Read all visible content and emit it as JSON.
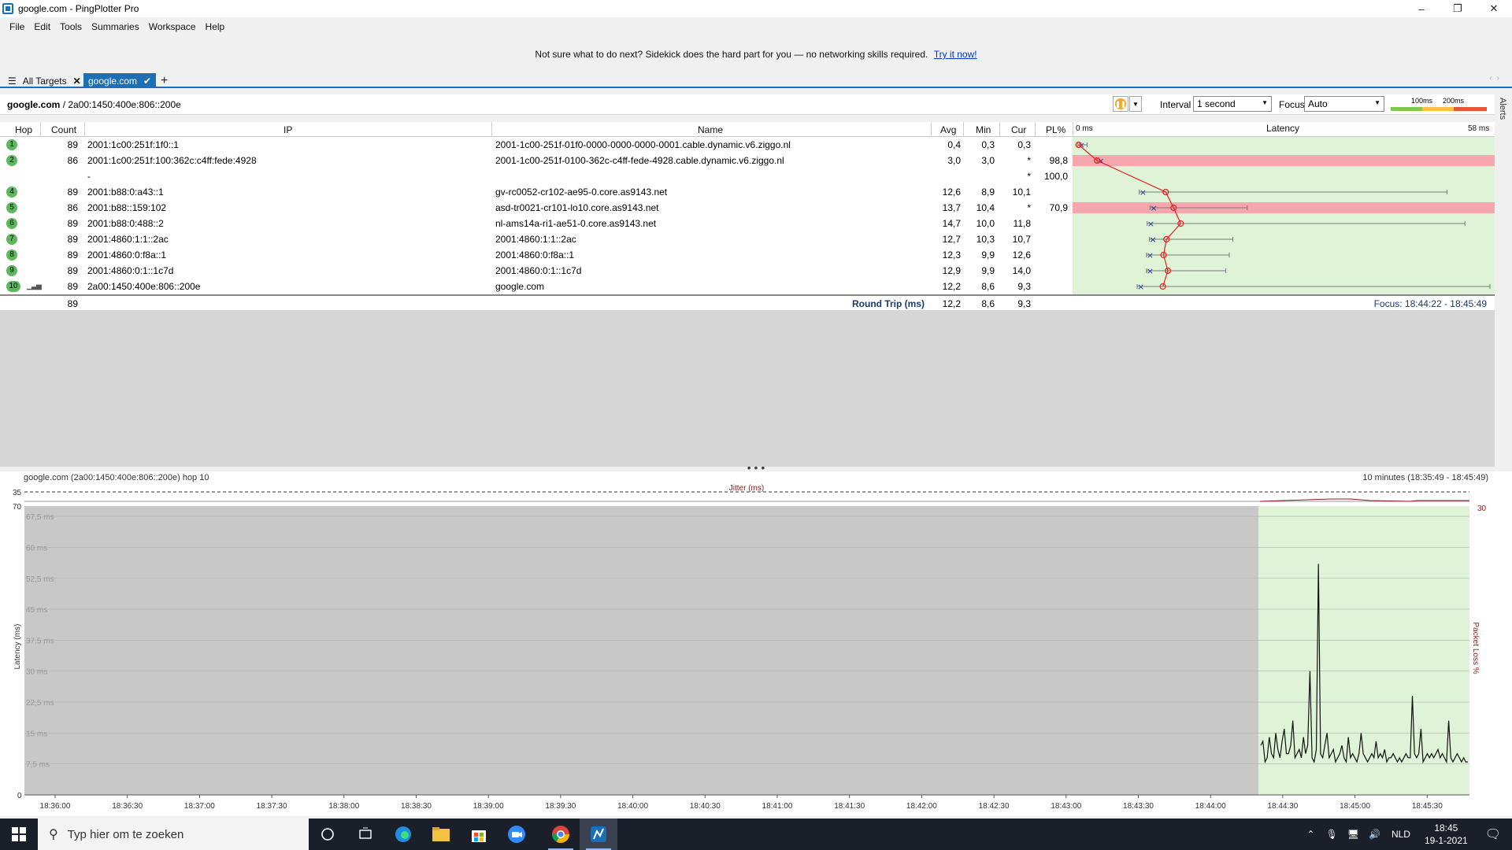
{
  "window": {
    "title": "google.com - PingPlotter Pro",
    "controls": [
      "–",
      "❐",
      "✕"
    ]
  },
  "menu": [
    "File",
    "Edit",
    "Tools",
    "Summaries",
    "Workspace",
    "Help"
  ],
  "banner": {
    "text": "Not sure what to do next? Sidekick does the hard part for you — no networking skills required.",
    "link": "Try it now!"
  },
  "tabs": {
    "all_targets": "All Targets",
    "active": "google.com",
    "add": "+"
  },
  "target": {
    "host": "google.com",
    "ip": "/ 2a00:1450:400e:806::200e",
    "interval_label": "Interval",
    "interval_value": "1 second",
    "focus_label": "Focus",
    "focus_value": "Auto",
    "thresholds": [
      "100ms",
      "200ms"
    ],
    "alerts_label": "Alerts"
  },
  "table": {
    "headers": {
      "hop": "Hop",
      "count": "Count",
      "ip": "IP",
      "name": "Name",
      "avg": "Avg",
      "min": "Min",
      "cur": "Cur",
      "pl": "PL%",
      "latency_min": "0 ms",
      "latency": "Latency",
      "latency_max": "58 ms"
    },
    "rows": [
      {
        "hop": "1",
        "count": "89",
        "ip": "2001:1c00:251f:1f0::1",
        "name": "2001-1c00-251f-01f0-0000-0000-0000-0001.cable.dynamic.v6.ziggo.nl",
        "avg": "0,4",
        "min": "0,3",
        "cur": "0,3",
        "pl": "",
        "latency_avg": 0.4,
        "latency_min": 0.3,
        "latency_max": 1.6,
        "loss": false
      },
      {
        "hop": "2",
        "count": "86",
        "ip": "2001:1c00:251f:100:362c:c4ff:fede:4928",
        "name": "2001-1c00-251f-0100-362c-c4ff-fede-4928.cable.dynamic.v6.ziggo.nl",
        "avg": "3,0",
        "min": "3,0",
        "cur": "*",
        "pl": "98,8",
        "latency_avg": 3.0,
        "latency_min": 3.0,
        "latency_max": 3.0,
        "loss": true
      },
      {
        "hop": "",
        "count": "",
        "ip": "-",
        "name": "",
        "avg": "",
        "min": "",
        "cur": "*",
        "pl": "100,0",
        "loss": false
      },
      {
        "hop": "4",
        "count": "89",
        "ip": "2001:b88:0:a43::1",
        "name": "gv-rc0052-cr102-ae95-0.core.as9143.net",
        "avg": "12,6",
        "min": "8,9",
        "cur": "10,1",
        "pl": "",
        "latency_avg": 12.6,
        "latency_min": 8.9,
        "latency_max": 52.0,
        "loss": false
      },
      {
        "hop": "5",
        "count": "86",
        "ip": "2001:b88::159:102",
        "name": "asd-tr0021-cr101-lo10.core.as9143.net",
        "avg": "13,7",
        "min": "10,4",
        "cur": "*",
        "pl": "70,9",
        "latency_avg": 13.7,
        "latency_min": 10.4,
        "latency_max": 24.0,
        "loss": true
      },
      {
        "hop": "6",
        "count": "89",
        "ip": "2001:b88:0:488::2",
        "name": "nl-ams14a-ri1-ae51-0.core.as9143.net",
        "avg": "14,7",
        "min": "10,0",
        "cur": "11,8",
        "pl": "",
        "latency_avg": 14.7,
        "latency_min": 10.0,
        "latency_max": 54.5,
        "loss": false
      },
      {
        "hop": "7",
        "count": "89",
        "ip": "2001:4860:1:1::2ac",
        "name": "2001:4860:1:1::2ac",
        "avg": "12,7",
        "min": "10,3",
        "cur": "10,7",
        "pl": "",
        "latency_avg": 12.7,
        "latency_min": 10.3,
        "latency_max": 22.0,
        "loss": false
      },
      {
        "hop": "8",
        "count": "89",
        "ip": "2001:4860:0:f8a::1",
        "name": "2001:4860:0:f8a::1",
        "avg": "12,3",
        "min": "9,9",
        "cur": "12,6",
        "pl": "",
        "latency_avg": 12.3,
        "latency_min": 9.9,
        "latency_max": 21.5,
        "loss": false
      },
      {
        "hop": "9",
        "count": "89",
        "ip": "2001:4860:0:1::1c7d",
        "name": "2001:4860:0:1::1c7d",
        "avg": "12,9",
        "min": "9,9",
        "cur": "14,0",
        "pl": "",
        "latency_avg": 12.9,
        "latency_min": 9.9,
        "latency_max": 21.0,
        "loss": false
      },
      {
        "hop": "10",
        "count": "89",
        "ip": "2a00:1450:400e:806::200e",
        "name": "google.com",
        "avg": "12,2",
        "min": "8,6",
        "cur": "9,3",
        "pl": "",
        "latency_avg": 12.2,
        "latency_min": 8.6,
        "latency_max": 58.0,
        "loss": false
      }
    ],
    "summary": {
      "count": "89",
      "label": "Round Trip (ms)",
      "avg": "12,2",
      "min": "8,6",
      "cur": "9,3",
      "focus": "Focus: 18:44:22 - 18:45:49"
    }
  },
  "timeline": {
    "title": "google.com (2a00:1450:400e:806::200e) hop 10",
    "range": "10 minutes (18:35:49 - 18:45:49)",
    "jitter_label": "Jitter (ms)",
    "jitter_max": "35",
    "y_max": "70",
    "y_min": "0",
    "loss_max": "30",
    "y_axis_label": "Latency (ms)",
    "loss_axis_label": "Packet Loss %",
    "gridlines": [
      "67,5 ms",
      "60 ms",
      "52,5 ms",
      "45 ms",
      "37,5 ms",
      "30 ms",
      "22,5 ms",
      "15 ms",
      "7,5 ms"
    ],
    "x_ticks": [
      "18:36:00",
      "18:36:30",
      "18:37:00",
      "18:37:30",
      "18:38:00",
      "18:38:30",
      "18:39:00",
      "18:39:30",
      "18:40:00",
      "18:40:30",
      "18:41:00",
      "18:41:30",
      "18:42:00",
      "18:42:30",
      "18:43:00",
      "18:43:30",
      "18:44:00",
      "18:44:30",
      "18:45:00",
      "18:45:30"
    ],
    "latency_series": [
      12,
      13,
      8,
      9,
      14,
      10,
      9,
      15,
      11,
      9,
      13,
      16,
      10,
      10,
      12,
      18,
      9,
      10,
      11,
      9,
      14,
      10,
      12,
      30,
      9,
      8,
      11,
      56,
      10,
      9,
      12,
      15,
      9,
      10,
      11,
      8,
      9,
      10,
      12,
      9,
      8,
      14,
      9,
      10,
      9,
      8,
      10,
      15,
      10,
      9,
      8,
      9,
      10,
      9,
      13,
      9,
      10,
      9,
      11,
      8,
      9,
      9,
      10,
      9,
      8,
      9,
      8,
      9,
      10,
      9,
      9,
      24,
      10,
      9,
      10,
      16,
      8,
      9,
      10,
      9,
      10,
      9,
      10,
      11,
      9,
      10,
      9,
      8,
      18,
      9,
      8,
      9,
      10,
      9,
      8,
      9,
      8,
      8
    ]
  },
  "taskbar": {
    "search_placeholder": "Typ hier om te zoeken",
    "language": "NLD",
    "time": "18:45",
    "date": "19-1-2021"
  }
}
